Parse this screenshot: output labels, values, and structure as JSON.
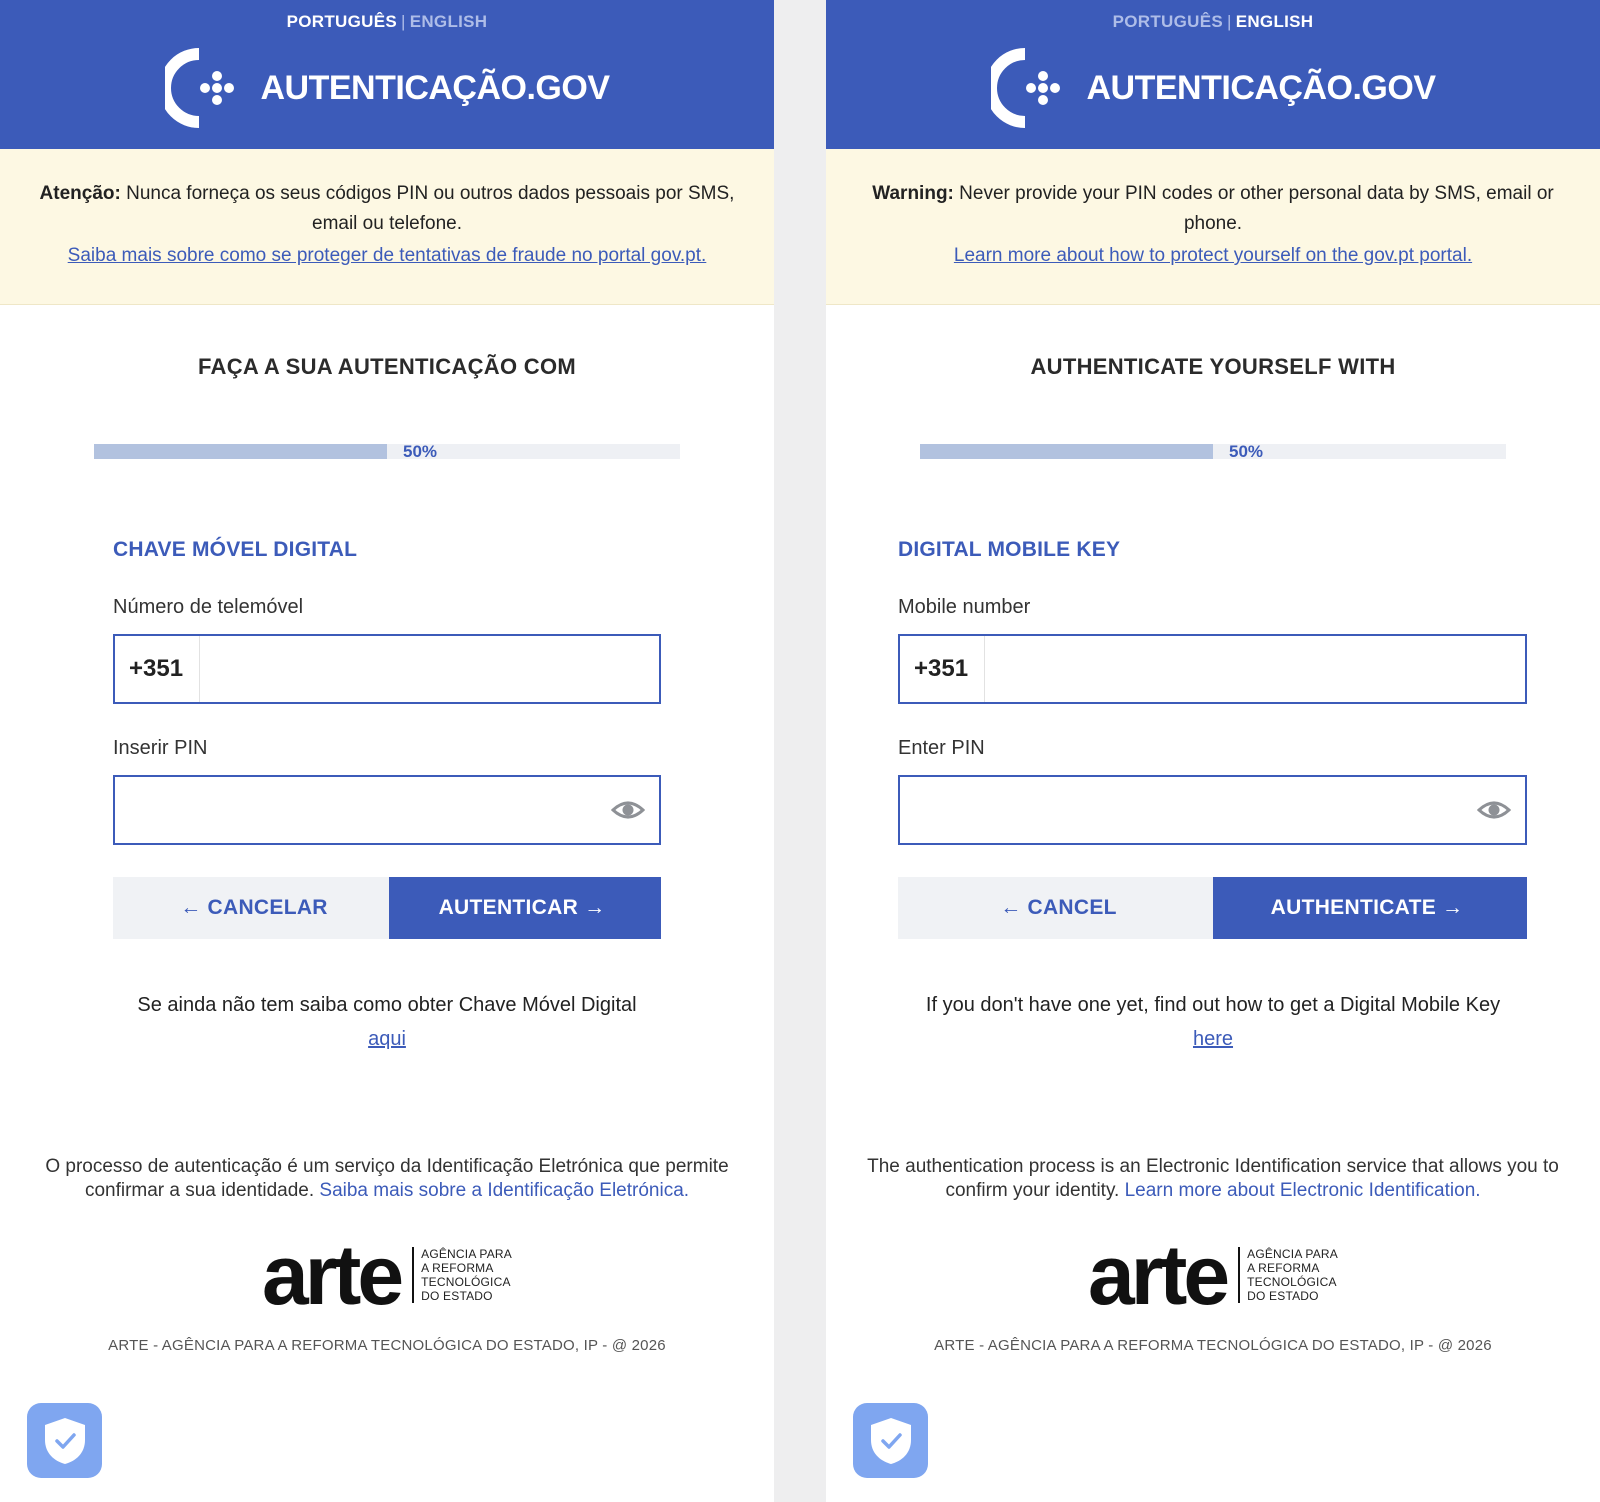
{
  "colors": {
    "brand_blue": "#3c5bb9",
    "warning_bg": "#fdf8e3",
    "progress_fill": "#b2c2df",
    "cancel_bg": "#f0f2f5",
    "shield_bg": "#7fa6f0"
  },
  "icons": {
    "logo": "autenticacao-gov-logo",
    "eye": "eye-icon",
    "shield": "shield-check-icon",
    "arrow_left": "←",
    "arrow_right": "→"
  },
  "pt": {
    "lang": {
      "portuguese": "PORTUGUÊS",
      "separator": "|",
      "english": "ENGLISH",
      "active": "portuguese"
    },
    "logo_text": "AUTENTICAÇÃO.GOV",
    "warning": {
      "label": "Atenção:",
      "text": "Nunca forneça os seus códigos PIN ou outros dados pessoais por SMS, email ou telefone.",
      "link": "Saiba mais sobre como se proteger de tentativas de fraude no portal gov.pt."
    },
    "section_title": "FAÇA A SUA AUTENTICAÇÃO COM",
    "progress": {
      "value": 50,
      "label": "50%"
    },
    "method_title": "CHAVE MÓVEL DIGITAL",
    "phone": {
      "label": "Número de telemóvel",
      "prefix": "+351",
      "value": ""
    },
    "pin": {
      "label": "Inserir PIN",
      "value": ""
    },
    "cancel_label": "CANCELAR",
    "auth_label": "AUTENTICAR",
    "help": {
      "text": "Se ainda não tem saiba como obter Chave Móvel Digital",
      "link": "aqui"
    },
    "about": {
      "text": "O processo de autenticação é um serviço da Identificação Eletrónica que permite confirmar a sua identidade.",
      "link": "Saiba mais sobre a Identificação Eletrónica."
    },
    "arte": {
      "word": "arte",
      "line1": "AGÊNCIA PARA",
      "line2": "A REFORMA",
      "line3": "TECNOLÓGICA",
      "line4": "DO ESTADO"
    },
    "copyright": "ARTE - AGÊNCIA PARA A REFORMA TECNOLÓGICA DO ESTADO, IP - @ 2026"
  },
  "en": {
    "lang": {
      "portuguese": "PORTUGUÊS",
      "separator": "|",
      "english": "ENGLISH",
      "active": "english"
    },
    "logo_text": "AUTENTICAÇÃO.GOV",
    "warning": {
      "label": "Warning:",
      "text": "Never provide your PIN codes or other personal data by SMS, email or phone.",
      "link": "Learn more about how to protect yourself on the gov.pt portal."
    },
    "section_title": "AUTHENTICATE YOURSELF WITH",
    "progress": {
      "value": 50,
      "label": "50%"
    },
    "method_title": "DIGITAL MOBILE KEY",
    "phone": {
      "label": "Mobile number",
      "prefix": "+351",
      "value": ""
    },
    "pin": {
      "label": "Enter PIN",
      "value": ""
    },
    "cancel_label": "CANCEL",
    "auth_label": "AUTHENTICATE",
    "help": {
      "text": "If you don't have one yet, find out how to get a Digital Mobile Key",
      "link": "here"
    },
    "about": {
      "text": "The authentication process is an Electronic Identification service that allows you to confirm your identity.",
      "link": "Learn more about Electronic Identification."
    },
    "arte": {
      "word": "arte",
      "line1": "AGÊNCIA PARA",
      "line2": "A REFORMA",
      "line3": "TECNOLÓGICA",
      "line4": "DO ESTADO"
    },
    "copyright": "ARTE - AGÊNCIA PARA A REFORMA TECNOLÓGICA DO ESTADO, IP - @ 2026"
  }
}
